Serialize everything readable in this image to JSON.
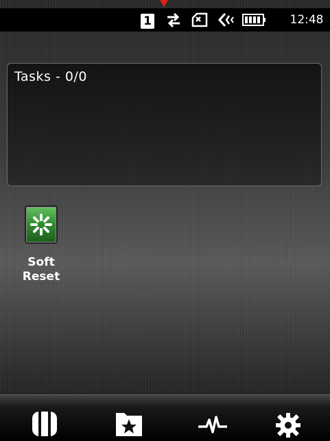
{
  "status_bar": {
    "badge": "1",
    "time": "12:48",
    "icons": [
      "connection-arrows-icon",
      "sim-card-icon",
      "speaker-icon",
      "battery-icon"
    ]
  },
  "task_panel": {
    "title": "Tasks - 0/0"
  },
  "apps": [
    {
      "label": "Soft\nReset",
      "icon": "soft-reset-icon",
      "accent": "#2e8b2e"
    }
  ],
  "bottom_bar": {
    "icons": [
      "phone-slab-icon",
      "favorites-folder-icon",
      "pulse-icon",
      "settings-gear-icon"
    ]
  }
}
